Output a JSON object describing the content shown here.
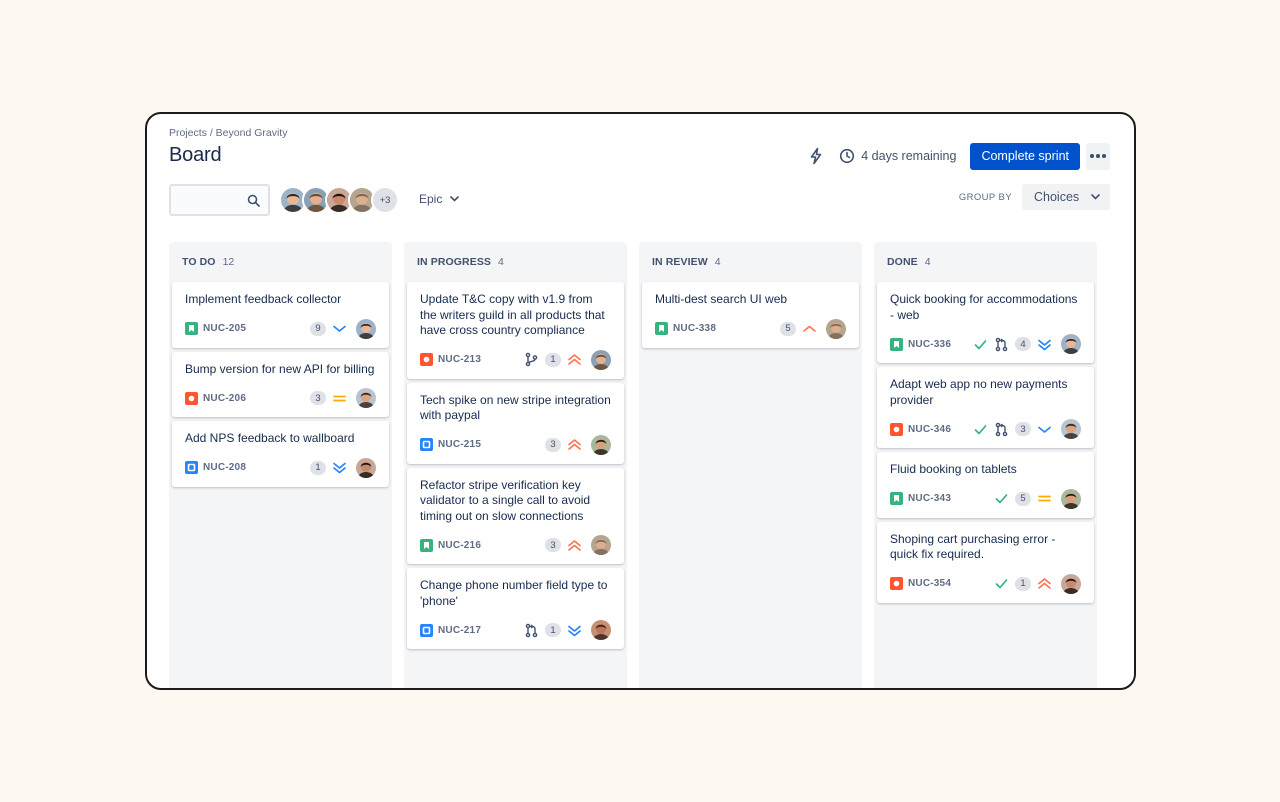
{
  "breadcrumb": "Projects / Beyond Gravity",
  "title": "Board",
  "header": {
    "remaining": "4 days remaining",
    "complete_label": "Complete sprint"
  },
  "toolbar": {
    "search_value": "",
    "more_avatars": "+3",
    "epic_label": "Epic",
    "group_by_label": "GROUP BY",
    "group_by_value": "Choices"
  },
  "colors": {
    "primary": "#0052cc",
    "story": "#36b37e",
    "bug": "#ff5630",
    "task": "#2684ff",
    "priority_high": "#ff7452",
    "priority_medium": "#ffab00",
    "priority_low": "#2684ff",
    "done_check": "#36b37e"
  },
  "columns": [
    {
      "name": "TO DO",
      "count": "12",
      "cards": [
        {
          "title": "Implement feedback collector",
          "key": "NUC-205",
          "type": "story",
          "points": "9",
          "priority": "low",
          "avatar": "a1"
        },
        {
          "title": "Bump version for new API for billing",
          "key": "NUC-206",
          "type": "bug",
          "points": "3",
          "priority": "medium",
          "avatar": "a2"
        },
        {
          "title": "Add NPS feedback to wallboard",
          "key": "NUC-208",
          "type": "task",
          "points": "1",
          "priority": "lowest",
          "avatar": "a3"
        }
      ]
    },
    {
      "name": "IN PROGRESS",
      "count": "4",
      "cards": [
        {
          "title": "Update T&C copy with v1.9 from the writers guild in all products that have cross country compliance",
          "key": "NUC-213",
          "type": "bug",
          "branch": "branch",
          "points": "1",
          "priority": "highest",
          "avatar": "a4"
        },
        {
          "title": "Tech spike on new stripe integration with paypal",
          "key": "NUC-215",
          "type": "task",
          "points": "3",
          "priority": "highest",
          "avatar": "a5"
        },
        {
          "title": "Refactor stripe verification key validator to a single call to avoid timing out on slow connections",
          "key": "NUC-216",
          "type": "story",
          "points": "3",
          "priority": "highest",
          "avatar": "a6"
        },
        {
          "title": "Change phone number field type to 'phone'",
          "key": "NUC-217",
          "type": "task",
          "branch": "pr",
          "points": "1",
          "priority": "lowest",
          "avatar": "a7"
        }
      ]
    },
    {
      "name": "IN REVIEW",
      "count": "4",
      "cards": [
        {
          "title": "Multi-dest search UI web",
          "key": "NUC-338",
          "type": "story",
          "points": "5",
          "priority": "high",
          "avatar": "a6"
        }
      ]
    },
    {
      "name": "DONE",
      "count": "4",
      "cards": [
        {
          "title": "Quick booking for accommodations - web",
          "key": "NUC-336",
          "type": "story",
          "done": true,
          "branch": "pr",
          "points": "4",
          "priority": "lowest",
          "avatar": "a1"
        },
        {
          "title": "Adapt web app no new payments provider",
          "key": "NUC-346",
          "type": "bug",
          "done": true,
          "branch": "pr",
          "points": "3",
          "priority": "low",
          "avatar": "a2"
        },
        {
          "title": "Fluid booking on tablets",
          "key": "NUC-343",
          "type": "story",
          "done": true,
          "points": "5",
          "priority": "medium",
          "avatar": "a5"
        },
        {
          "title": "Shoping cart purchasing error - quick fix required.",
          "key": "NUC-354",
          "type": "bug",
          "done": true,
          "points": "1",
          "priority": "highest",
          "avatar": "a3"
        }
      ]
    }
  ]
}
